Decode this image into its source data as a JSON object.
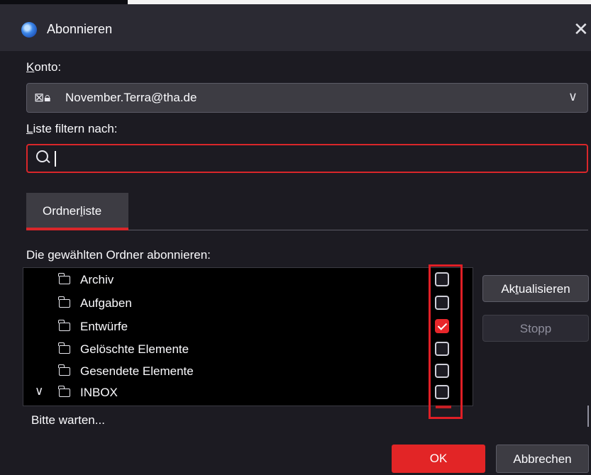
{
  "window": {
    "title": "Abonnieren"
  },
  "account": {
    "label_hotkey": "K",
    "label_rest": "onto:",
    "value": "November.Terra@tha.de"
  },
  "filter": {
    "label_hotkey": "L",
    "label_rest": "iste filtern nach:",
    "value": ""
  },
  "tabs": [
    {
      "label_pre": "Ordner",
      "label_hotkey": "l",
      "label_post": "iste",
      "selected": true
    }
  ],
  "list_heading": "Die gewählten Ordner abonnieren:",
  "folders": [
    {
      "name": "Archiv",
      "checked": false
    },
    {
      "name": "Aufgaben",
      "checked": false
    },
    {
      "name": "Entwürfe",
      "checked": true
    },
    {
      "name": "Gelöschte Elemente",
      "checked": false
    },
    {
      "name": "Gesendete Elemente",
      "checked": false
    },
    {
      "name": "INBOX",
      "checked": false,
      "expanded": true
    }
  ],
  "buttons": {
    "refresh_pre": "Ak",
    "refresh_hotkey": "t",
    "refresh_post": "ualisieren",
    "stop_label": "Stopp",
    "ok_label": "OK",
    "cancel_label": "Abbrechen"
  },
  "status_text": "Bitte warten...",
  "colors": {
    "accent_red": "#e22526",
    "background": "#1c1b22"
  }
}
